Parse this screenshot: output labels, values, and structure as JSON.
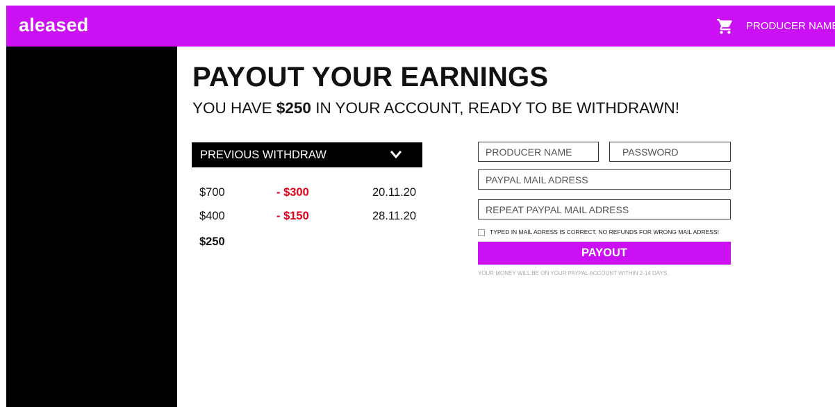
{
  "header": {
    "logo": "aleased",
    "cart_icon": "cart-icon",
    "user_label": "PRODUCER NAME",
    "accent_color": "#cc10f4"
  },
  "page": {
    "title": "PAYOUT YOUR EARNINGS",
    "subtitle_prefix": "YOU HAVE ",
    "subtitle_amount": "$250",
    "subtitle_suffix": " IN YOUR ACCOUNT, READY TO BE WITHDRAWN!"
  },
  "withdraw": {
    "header_label": "PREVIOUS WITHDRAW",
    "chevron_icon": "chevron-down-icon",
    "rows": [
      {
        "amount": "$700",
        "change": "- $300",
        "date": "20.11.20"
      },
      {
        "amount": "$400",
        "change": "- $150",
        "date": "28.11.20"
      }
    ],
    "total": "$250"
  },
  "form": {
    "producer_placeholder": "PRODUCER NAME",
    "password_placeholder": "PASSWORD",
    "paypal_placeholder": "PAYPAL MAIL ADRESS",
    "repeat_paypal_placeholder": "REPEAT PAYPAL MAIL ADRESS",
    "confirm_text": "TYPED IN MAIL ADRESS IS CORRECT. NO REFUNDS FOR WRONG MAIL ADRESS!",
    "confirm_checked": false,
    "submit_label": "PAYOUT",
    "note": "YOUR MONEY WILL BE ON YOUR PAYPAL ACCOUNT WITHIN 2-14 DAYS."
  }
}
